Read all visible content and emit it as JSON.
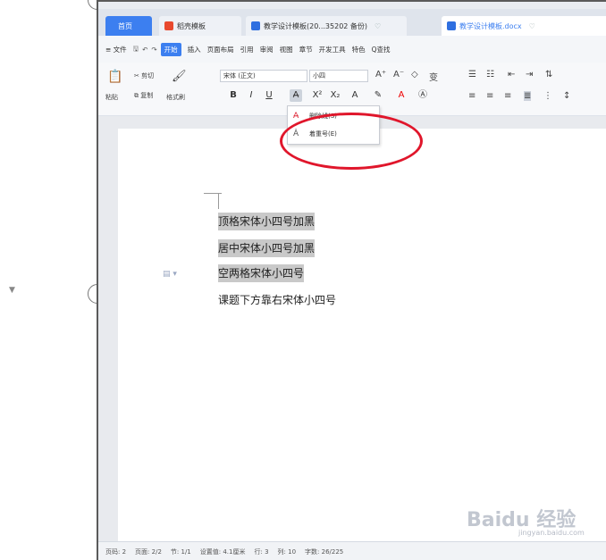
{
  "tabs": {
    "home": "首页",
    "daoke": "稻壳模板",
    "doc1": "教学设计模板(20...35202 备份)",
    "doc2": "教学设计模板.docx"
  },
  "menu": {
    "file": "≡ 文件",
    "start": "开始",
    "insert": "插入",
    "layout": "页面布局",
    "ref": "引用",
    "review": "审阅",
    "view": "视图",
    "chapter": "章节",
    "dev": "开发工具",
    "special": "特色",
    "search": "Q查找"
  },
  "ribbon": {
    "cut": "剪切",
    "copy": "复制",
    "paste": "粘贴",
    "format_painter": "格式刷",
    "font_name": "宋体 (正文)",
    "font_size": "小四"
  },
  "dropdown": {
    "item1": "删除线(S)",
    "item2": "着重号(E)"
  },
  "document": {
    "lines": [
      "顶格宋体小四号加黑",
      "居中宋体小四号加黑",
      "空两格宋体小四号",
      "课题下方靠右宋体小四号"
    ]
  },
  "status": {
    "page": "页码: 2",
    "pages": "页面: 2/2",
    "section": "节: 1/1",
    "setting": "设置值: 4.1厘米",
    "row": "行: 3",
    "col": "列: 10",
    "words": "字数: 26/225"
  },
  "watermark": {
    "brand": "Baidu 经验",
    "domain": "jingyan.baidu.com"
  }
}
